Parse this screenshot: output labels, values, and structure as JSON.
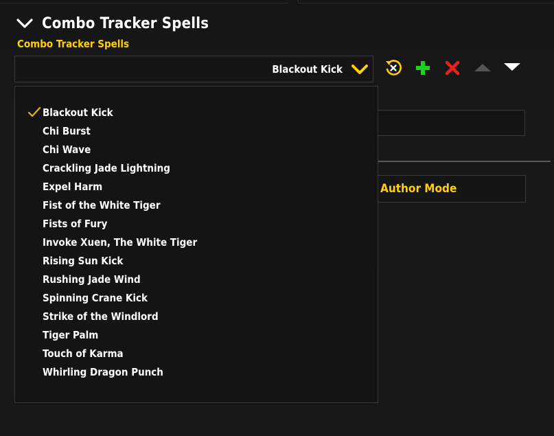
{
  "section": {
    "title": "Combo Tracker Spells"
  },
  "field": {
    "label": "Combo Tracker Spells",
    "selected": "Blackout Kick"
  },
  "toolbar": {
    "icons": [
      "reset-icon",
      "add-icon",
      "delete-icon",
      "move-up-icon",
      "move-down-icon"
    ],
    "colors": {
      "reset": "#ffd100",
      "add": "#1fd11f",
      "delete": "#e82020",
      "move_up_disabled": "#555555",
      "move_down": "#ffffff"
    }
  },
  "background": {
    "author_mode_label": "Author Mode"
  },
  "dropdown_list": {
    "items": [
      {
        "label": "Blackout Kick",
        "checked": true
      },
      {
        "label": "Chi Burst",
        "checked": false
      },
      {
        "label": "Chi Wave",
        "checked": false
      },
      {
        "label": "Crackling Jade Lightning",
        "checked": false
      },
      {
        "label": "Expel Harm",
        "checked": false
      },
      {
        "label": "Fist of the White Tiger",
        "checked": false
      },
      {
        "label": "Fists of Fury",
        "checked": false
      },
      {
        "label": "Invoke Xuen, The White Tiger",
        "checked": false
      },
      {
        "label": "Rising Sun Kick",
        "checked": false
      },
      {
        "label": "Rushing Jade Wind",
        "checked": false
      },
      {
        "label": "Spinning Crane Kick",
        "checked": false
      },
      {
        "label": "Strike of the Windlord",
        "checked": false
      },
      {
        "label": "Tiger Palm",
        "checked": false
      },
      {
        "label": "Touch of Karma",
        "checked": false
      },
      {
        "label": "Whirling Dragon Punch",
        "checked": false
      }
    ]
  },
  "colors": {
    "accent_gold": "#ffd100",
    "text": "#ffffff",
    "background": "#171717",
    "border": "#3a3a3a"
  }
}
